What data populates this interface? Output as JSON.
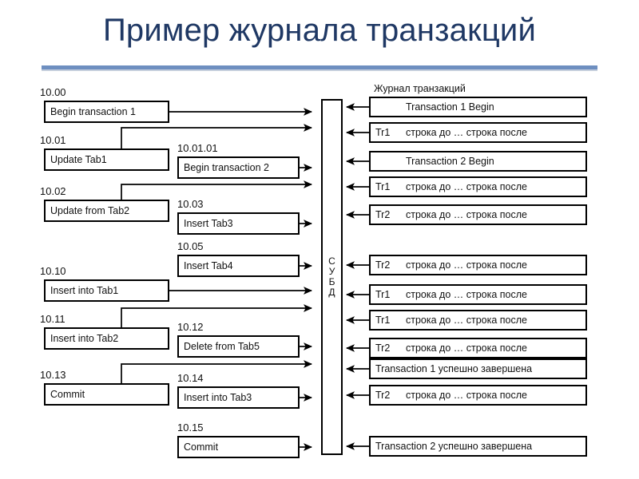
{
  "title": "Пример журнала транзакций",
  "dbms": {
    "label": "СУБД",
    "chars": [
      "С",
      "У",
      "Б",
      "Д"
    ]
  },
  "log": {
    "header": "Журнал транзакций",
    "entries": [
      {
        "prefix": "",
        "text": "Transaction 1 Begin"
      },
      {
        "prefix": "Tr1",
        "text": "строка до … строка после"
      },
      {
        "prefix": "",
        "text": "Transaction 2 Begin"
      },
      {
        "prefix": "Tr1",
        "text": "строка до … строка после"
      },
      {
        "prefix": "Tr2",
        "text": "строка до … строка после"
      },
      {
        "prefix": "Tr2",
        "text": "строка до … строка после"
      },
      {
        "prefix": "Tr1",
        "text": "строка до … строка после"
      },
      {
        "prefix": "Tr1",
        "text": "строка до … строка после"
      },
      {
        "prefix": "Tr2",
        "text": "строка до … строка после"
      },
      {
        "prefix": "",
        "text": "Transaction 1 успешно завершена"
      },
      {
        "prefix": "Tr2",
        "text": "строка до … строка после"
      },
      {
        "prefix": "",
        "text": "Transaction 2 успешно завершена"
      }
    ]
  },
  "left_column": [
    {
      "time": "10.00",
      "text": "Begin transaction 1"
    },
    {
      "time": "10.01",
      "text": "Update Tab1"
    },
    {
      "time": "10.02",
      "text": "Update from Tab2"
    },
    {
      "time": "10.10",
      "text": "Insert into Tab1"
    },
    {
      "time": "10.11",
      "text": "Insert into Tab2"
    },
    {
      "time": "10.13",
      "text": "Commit"
    }
  ],
  "middle_column": [
    {
      "time": "10.01.01",
      "text": "Begin transaction 2"
    },
    {
      "time": "10.03",
      "text": "Insert Tab3"
    },
    {
      "time": "10.05",
      "text": "Insert Tab4"
    },
    {
      "time": "10.12",
      "text": "Delete from Tab5"
    },
    {
      "time": "10.14",
      "text": "Insert into Tab3"
    },
    {
      "time": "10.15",
      "text": "Commit"
    }
  ],
  "colors": {
    "title": "#1F3864",
    "rule": "#6E8FC0",
    "rule_thin": "#C6CFDD",
    "stroke": "#000000",
    "background": "#FFFFFF"
  }
}
